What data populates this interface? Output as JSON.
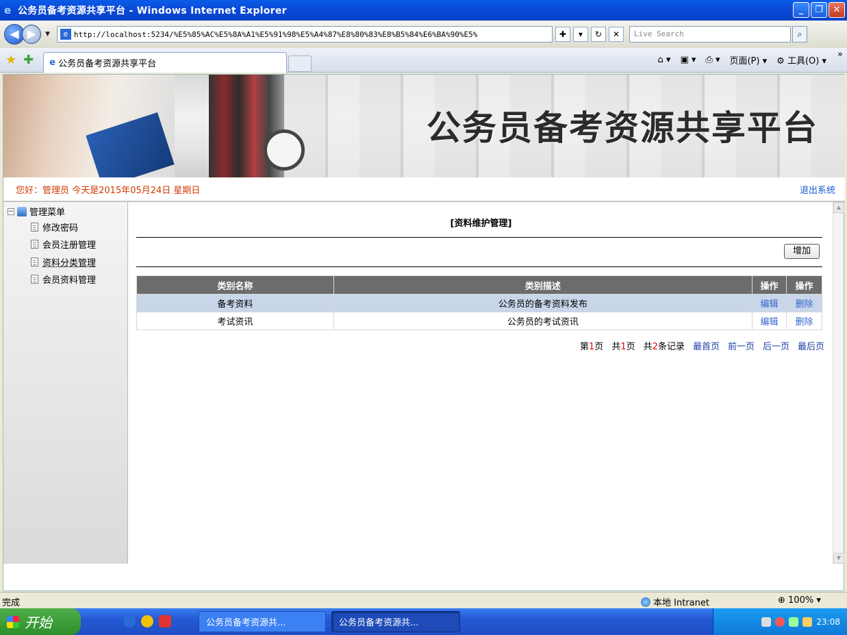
{
  "window": {
    "title": "公务员备考资源共享平台 - Windows Internet Explorer",
    "controls": {
      "minimize": "_",
      "maximize": "❐",
      "close": "✕"
    }
  },
  "browser": {
    "address": "http://localhost:5234/%E5%85%AC%E5%8A%A1%E5%91%98%E5%A4%87%E8%80%83%E8%B5%84%E6%BA%90%E5%",
    "search_placeholder": "Live Search",
    "tab_title": "公务员备考资源共享平台",
    "menu_page": "页面(P)",
    "menu_tools": "工具(O)"
  },
  "page": {
    "site_title": "公务员备考资源共享平台",
    "greeting": "您好：管理员   今天是2015年05月24日   星期日",
    "logout": "退出系统"
  },
  "sidebar": {
    "root": "管理菜单",
    "items": [
      {
        "label": "修改密码"
      },
      {
        "label": "会员注册管理"
      },
      {
        "label": "资料分类管理"
      },
      {
        "label": "会员资料管理"
      }
    ]
  },
  "main": {
    "title": "[资料维护管理]",
    "add_button": "增加",
    "columns": [
      "类别名称",
      "类别描述",
      "操作",
      "操作"
    ],
    "rows": [
      {
        "name": "备考资料",
        "desc": "公务员的备考资料发布",
        "edit": "编辑",
        "delete": "删除"
      },
      {
        "name": "考试资讯",
        "desc": "公务员的考试资讯",
        "edit": "编辑",
        "delete": "删除"
      }
    ],
    "pager": {
      "page_prefix": "第",
      "page_num": "1",
      "page_suffix": "页",
      "total_prefix": "共",
      "total_pages": "1",
      "total_suffix": "页",
      "records_prefix": "共",
      "records": "2",
      "records_suffix": "条记录",
      "first": "最首页",
      "prev": "前一页",
      "next": "后一页",
      "last": "最后页"
    }
  },
  "status": {
    "text": "完成",
    "zone": "本地 Intranet",
    "zoom": "100%"
  },
  "taskbar": {
    "start": "开始",
    "tasks": [
      "公务员备考资源共...",
      "公务员备考资源共..."
    ],
    "time": "23:08"
  },
  "colors": {
    "greeting": "#d23a00",
    "link": "#3366cc",
    "header_bg": "#6c6c6c",
    "selected_row": "#c9d6ea"
  }
}
